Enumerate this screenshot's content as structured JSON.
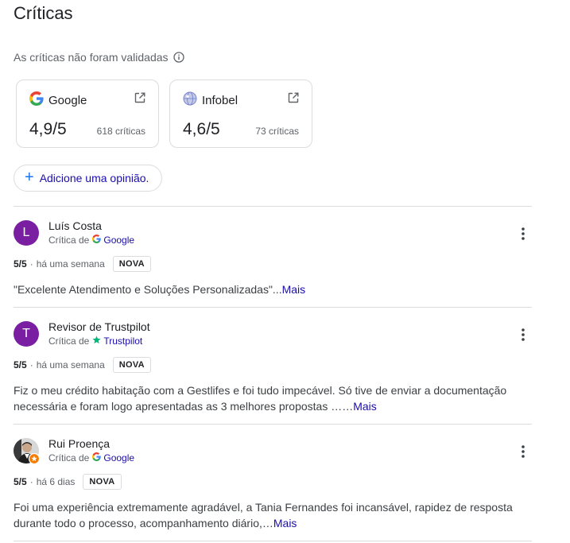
{
  "header": {
    "title": "Críticas",
    "unvalidated_text": "As críticas não foram validadas"
  },
  "sources": [
    {
      "name": "Google",
      "rating": "4,9/5",
      "count": "618 críticas",
      "icon": "google-g-icon"
    },
    {
      "name": "Infobel",
      "rating": "4,6/5",
      "count": "73 críticas",
      "icon": "globe-icon"
    }
  ],
  "add_review": {
    "label": "Adicione uma opinião."
  },
  "reviews": [
    {
      "avatar_letter": "L",
      "name": "Luís Costa",
      "source_prefix": "Crítica de",
      "source": "Google",
      "score": "5/5",
      "time": "há uma semana",
      "badge": "NOVA",
      "text": "\"Excelente Atendimento e Soluções Personalizadas\"...",
      "more": "Mais"
    },
    {
      "avatar_letter": "T",
      "name": "Revisor de Trustpilot",
      "source_prefix": "Crítica de",
      "source": "Trustpilot",
      "score": "5/5",
      "time": "há uma semana",
      "badge": "NOVA",
      "text": "Fiz o meu crédito habitação com a Gestlifes e foi tudo impecável. Só tive de enviar a documentação necessária e foram logo apresentadas as 3 melhores propostas ……",
      "more": "Mais"
    },
    {
      "avatar_letter": "",
      "name": "Rui Proença",
      "source_prefix": "Crítica de",
      "source": "Google",
      "score": "5/5",
      "time": "há 6 dias",
      "badge": "NOVA",
      "text": "Foi uma experiência extremamente agradável, a Tania Fernandes foi incansável, rapidez de resposta durante todo o processo, acompanhamento diário,…",
      "more": "Mais"
    }
  ],
  "colors": {
    "link": "#1a0dab",
    "avatar_purple": "#7b1fa2",
    "trustpilot_green": "#00b67a",
    "local_guide_orange": "#f57c00"
  }
}
